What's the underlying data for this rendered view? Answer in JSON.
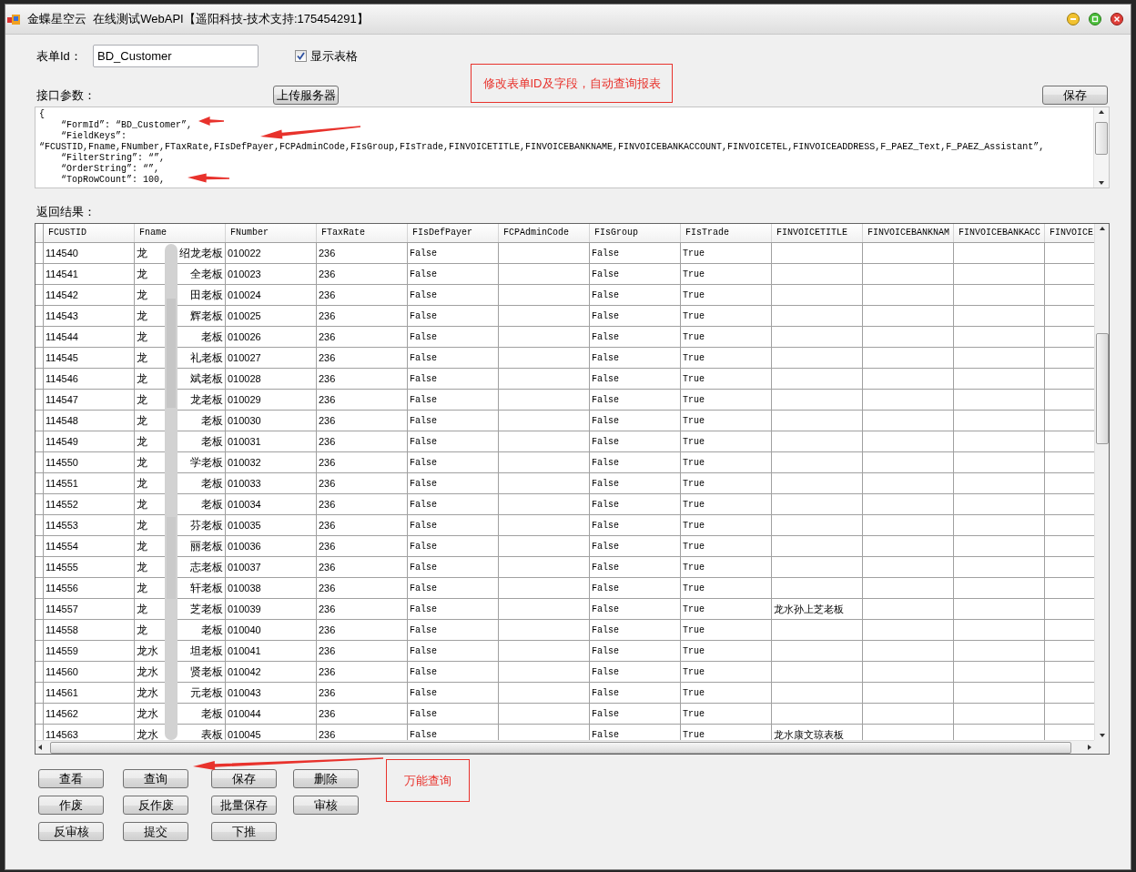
{
  "window": {
    "title": "金蝶星空云  在线测试WebAPI【遥阳科技-技术支持:175454291】"
  },
  "form_id": {
    "label": "表单Id：",
    "value": "BD_Customer"
  },
  "show_grid": {
    "label": "显示表格",
    "checked": true
  },
  "params": {
    "label": "接口参数：",
    "upload_button": "上传服务器",
    "save_button": "保存",
    "lines": [
      "{",
      "    “FormId”: “BD_Customer”,",
      "    “FieldKeys”:",
      "“FCUSTID,Fname,FNumber,FTaxRate,FIsDefPayer,FCPAdminCode,FIsGroup,FIsTrade,FINVOICETITLE,FINVOICEBANKNAME,FINVOICEBANKACCOUNT,FINVOICETEL,FINVOICEADDRESS,F_PAEZ_Text,F_PAEZ_Assistant”,",
      "    “FilterString”: “”,",
      "    “OrderString”: “”,",
      "    “TopRowCount”: 100,"
    ]
  },
  "annotations": [
    {
      "text": "修改表单ID及字段，自动查询报表"
    },
    {
      "text": "万能查询"
    }
  ],
  "result": {
    "label": "返回结果：",
    "columns": [
      "FCUSTID",
      "Fname",
      "FNumber",
      "FTaxRate",
      "FIsDefPayer",
      "FCPAdminCode",
      "FIsGroup",
      "FIsTrade",
      "FINVOICETITLE",
      "FINVOICEBANKNAM",
      "FINVOICEBANKACC",
      "FINVOICE"
    ],
    "rows": [
      {
        "id": "114540",
        "name_start": "龙",
        "name_end": "绍龙老板",
        "number": "010022",
        "tax_rate": "236",
        "is_def_payer": "False",
        "is_group": "False",
        "is_trade": "True"
      },
      {
        "id": "114541",
        "name_start": "龙",
        "name_end": "全老板",
        "number": "010023",
        "tax_rate": "236",
        "is_def_payer": "False",
        "is_group": "False",
        "is_trade": "True"
      },
      {
        "id": "114542",
        "name_start": "龙",
        "name_end": "田老板",
        "number": "010024",
        "tax_rate": "236",
        "is_def_payer": "False",
        "is_group": "False",
        "is_trade": "True"
      },
      {
        "id": "114543",
        "name_start": "龙",
        "name_end": "辉老板",
        "number": "010025",
        "tax_rate": "236",
        "is_def_payer": "False",
        "is_group": "False",
        "is_trade": "True"
      },
      {
        "id": "114544",
        "name_start": "龙",
        "name_end": "老板",
        "number": "010026",
        "tax_rate": "236",
        "is_def_payer": "False",
        "is_group": "False",
        "is_trade": "True"
      },
      {
        "id": "114545",
        "name_start": "龙",
        "name_end": "礼老板",
        "number": "010027",
        "tax_rate": "236",
        "is_def_payer": "False",
        "is_group": "False",
        "is_trade": "True"
      },
      {
        "id": "114546",
        "name_start": "龙",
        "name_end": "斌老板",
        "number": "010028",
        "tax_rate": "236",
        "is_def_payer": "False",
        "is_group": "False",
        "is_trade": "True"
      },
      {
        "id": "114547",
        "name_start": "龙",
        "name_end": "龙老板",
        "number": "010029",
        "tax_rate": "236",
        "is_def_payer": "False",
        "is_group": "False",
        "is_trade": "True"
      },
      {
        "id": "114548",
        "name_start": "龙",
        "name_end": "老板",
        "number": "010030",
        "tax_rate": "236",
        "is_def_payer": "False",
        "is_group": "False",
        "is_trade": "True"
      },
      {
        "id": "114549",
        "name_start": "龙",
        "name_end": "老板",
        "number": "010031",
        "tax_rate": "236",
        "is_def_payer": "False",
        "is_group": "False",
        "is_trade": "True"
      },
      {
        "id": "114550",
        "name_start": "龙",
        "name_end": "学老板",
        "number": "010032",
        "tax_rate": "236",
        "is_def_payer": "False",
        "is_group": "False",
        "is_trade": "True"
      },
      {
        "id": "114551",
        "name_start": "龙",
        "name_end": "老板",
        "number": "010033",
        "tax_rate": "236",
        "is_def_payer": "False",
        "is_group": "False",
        "is_trade": "True"
      },
      {
        "id": "114552",
        "name_start": "龙",
        "name_end": "老板",
        "number": "010034",
        "tax_rate": "236",
        "is_def_payer": "False",
        "is_group": "False",
        "is_trade": "True"
      },
      {
        "id": "114553",
        "name_start": "龙",
        "name_end": "芬老板",
        "number": "010035",
        "tax_rate": "236",
        "is_def_payer": "False",
        "is_group": "False",
        "is_trade": "True"
      },
      {
        "id": "114554",
        "name_start": "龙",
        "name_end": "丽老板",
        "number": "010036",
        "tax_rate": "236",
        "is_def_payer": "False",
        "is_group": "False",
        "is_trade": "True"
      },
      {
        "id": "114555",
        "name_start": "龙",
        "name_end": "志老板",
        "number": "010037",
        "tax_rate": "236",
        "is_def_payer": "False",
        "is_group": "False",
        "is_trade": "True"
      },
      {
        "id": "114556",
        "name_start": "龙",
        "name_end": "轩老板",
        "number": "010038",
        "tax_rate": "236",
        "is_def_payer": "False",
        "is_group": "False",
        "is_trade": "True"
      },
      {
        "id": "114557",
        "name_start": "龙",
        "name_end": "芝老板",
        "number": "010039",
        "tax_rate": "236",
        "is_def_payer": "False",
        "is_group": "False",
        "is_trade": "True",
        "invoice_title": "龙水孙上芝老板"
      },
      {
        "id": "114558",
        "name_start": "龙",
        "name_end": "老板",
        "number": "010040",
        "tax_rate": "236",
        "is_def_payer": "False",
        "is_group": "False",
        "is_trade": "True"
      },
      {
        "id": "114559",
        "name_start": "龙水",
        "name_end": "坦老板",
        "number": "010041",
        "tax_rate": "236",
        "is_def_payer": "False",
        "is_group": "False",
        "is_trade": "True"
      },
      {
        "id": "114560",
        "name_start": "龙水",
        "name_end": "贤老板",
        "number": "010042",
        "tax_rate": "236",
        "is_def_payer": "False",
        "is_group": "False",
        "is_trade": "True"
      },
      {
        "id": "114561",
        "name_start": "龙水",
        "name_end": "元老板",
        "number": "010043",
        "tax_rate": "236",
        "is_def_payer": "False",
        "is_group": "False",
        "is_trade": "True"
      },
      {
        "id": "114562",
        "name_start": "龙水",
        "name_end": "老板",
        "number": "010044",
        "tax_rate": "236",
        "is_def_payer": "False",
        "is_group": "False",
        "is_trade": "True"
      },
      {
        "id": "114563",
        "name_start": "龙水",
        "name_end": "表板",
        "number": "010045",
        "tax_rate": "236",
        "is_def_payer": "False",
        "is_group": "False",
        "is_trade": "True",
        "invoice_title": "龙水康文琼表板"
      }
    ]
  },
  "buttons": [
    [
      "查看",
      "查询",
      "保存",
      "删除"
    ],
    [
      "作废",
      "反作废",
      "批量保存",
      "审核"
    ],
    [
      "反审核",
      "提交",
      "下推"
    ]
  ]
}
